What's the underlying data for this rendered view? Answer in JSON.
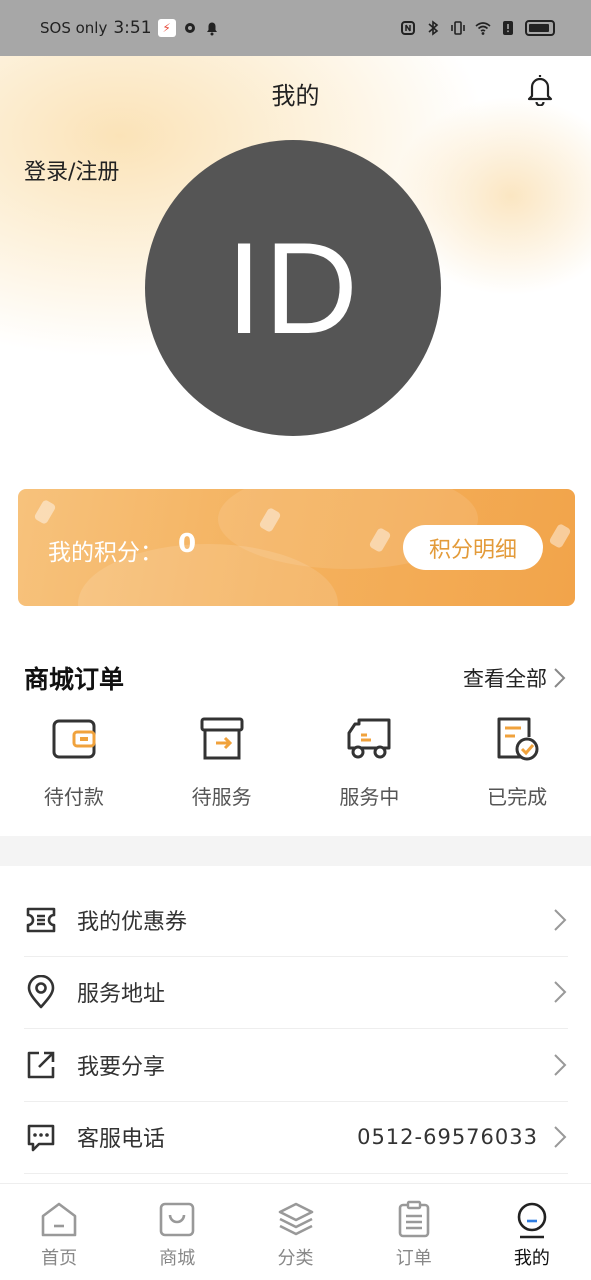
{
  "status_bar": {
    "carrier": "SOS only",
    "time": "3:51"
  },
  "header": {
    "title": "我的",
    "login_label": "登录/注册",
    "avatar_text": "ID"
  },
  "points": {
    "label": "我的积分：",
    "value": "0",
    "detail_button": "积分明细"
  },
  "orders": {
    "title": "商城订单",
    "view_all": "查看全部",
    "items": [
      {
        "label": "待付款",
        "icon": "wallet-icon"
      },
      {
        "label": "待服务",
        "icon": "box-icon"
      },
      {
        "label": "服务中",
        "icon": "truck-icon"
      },
      {
        "label": "已完成",
        "icon": "done-icon"
      }
    ]
  },
  "menu": {
    "items": [
      {
        "label": "我的优惠券",
        "icon": "coupon-icon",
        "value": ""
      },
      {
        "label": "服务地址",
        "icon": "location-icon",
        "value": ""
      },
      {
        "label": "我要分享",
        "icon": "share-icon",
        "value": ""
      },
      {
        "label": "客服电话",
        "icon": "chat-icon",
        "value": "0512-69576033"
      }
    ]
  },
  "tabbar": {
    "items": [
      {
        "label": "首页",
        "icon": "home-icon",
        "active": false
      },
      {
        "label": "商城",
        "icon": "shop-icon",
        "active": false
      },
      {
        "label": "分类",
        "icon": "category-icon",
        "active": false
      },
      {
        "label": "订单",
        "icon": "order-icon",
        "active": false
      },
      {
        "label": "我的",
        "icon": "profile-icon",
        "active": true
      }
    ]
  },
  "colors": {
    "accent": "#e39b3a",
    "points_card": "#f4b25f",
    "avatar_bg": "#555555",
    "status_bar": "#a7a7a7"
  }
}
